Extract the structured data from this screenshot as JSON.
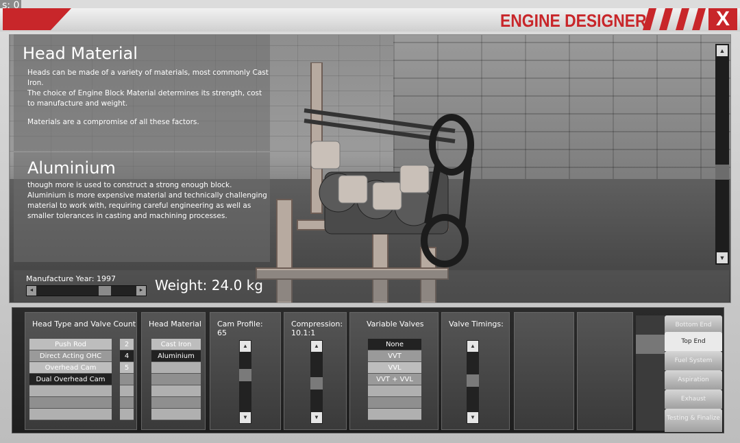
{
  "fps": "s: 0",
  "app": {
    "title": "ENGINE DESIGNER",
    "close_label": "X"
  },
  "info": {
    "heading": "Head Material",
    "lines": [
      "Heads can be made of a variety of materials, most commonly Cast",
      "Iron.",
      "The choice of Engine Block Material determines its strength, cost",
      "to manufacture and weight.",
      "",
      "Materials are a compromise of all these factors."
    ]
  },
  "material": {
    "heading": "Aluminium",
    "lines": [
      "though more is used to construct a strong enough block.",
      "Aluminium is more expensive material and technically challenging",
      "material to work with, requiring careful engineering as well as",
      "smaller tolerances in casting and machining processes."
    ]
  },
  "year": {
    "label": "Manufacture Year: 1997",
    "value": 1997
  },
  "weight": "Weight: 24.0 kg",
  "columns": {
    "head_type": {
      "title": "Head Type and Valve Count",
      "options": [
        "Push Rod",
        "Direct Acting OHC",
        "Overhead Cam",
        "Dual Overhead Cam"
      ],
      "selected": "Dual Overhead Cam",
      "valves": [
        "2",
        "4",
        "5"
      ],
      "selected_valves": "4"
    },
    "head_material": {
      "title": "Head Material",
      "options": [
        "Cast Iron",
        "Aluminium"
      ],
      "selected": "Aluminium"
    },
    "cam_profile": {
      "title": "Cam Profile:",
      "value": "65"
    },
    "compression": {
      "title": "Compression:",
      "value": "10.1:1"
    },
    "variable_valves": {
      "title": "Variable Valves",
      "options": [
        "None",
        "VVT",
        "VVL",
        "VVT + VVL"
      ],
      "selected": "None"
    },
    "valve_timings": {
      "title": "Valve Timings:"
    }
  },
  "tabs": [
    {
      "label": "Bottom End",
      "selected": false
    },
    {
      "label": "Top End",
      "selected": true
    },
    {
      "label": "Fuel System",
      "selected": false
    },
    {
      "label": "Aspiration",
      "selected": false
    },
    {
      "label": "Exhaust",
      "selected": false
    },
    {
      "label": "Testing & Finalize",
      "selected": false
    }
  ],
  "arrows": {
    "up": "▲",
    "down": "▼",
    "left": "◄",
    "right": "►"
  },
  "colors": {
    "accent": "#c8262a",
    "panel": "#3a3a3a"
  }
}
